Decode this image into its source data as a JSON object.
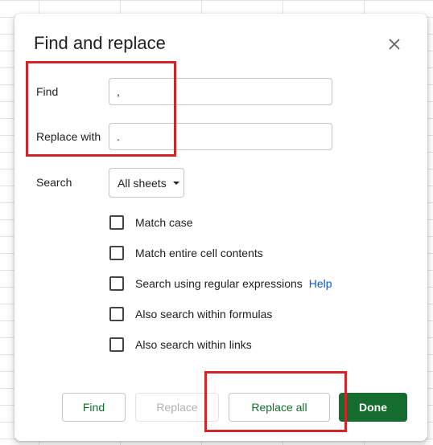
{
  "dialog": {
    "title": "Find and replace",
    "find_label": "Find",
    "find_value": ",",
    "replace_label": "Replace with",
    "replace_value": ".",
    "search_label": "Search",
    "search_scope": "All sheets"
  },
  "options": [
    {
      "label": "Match case",
      "checked": false
    },
    {
      "label": "Match entire cell contents",
      "checked": false
    },
    {
      "label": "Search using regular expressions",
      "checked": false,
      "help": "Help"
    },
    {
      "label": "Also search within formulas",
      "checked": false
    },
    {
      "label": "Also search within links",
      "checked": false
    }
  ],
  "buttons": {
    "find": "Find",
    "replace": "Replace",
    "replace_all": "Replace all",
    "done": "Done"
  },
  "colors": {
    "accent_green": "#146c2e",
    "link_blue": "#0b57d0",
    "annotation_red": "#d0262b"
  },
  "icons": {
    "close": "close-icon",
    "dropdown": "caret-down-icon"
  }
}
